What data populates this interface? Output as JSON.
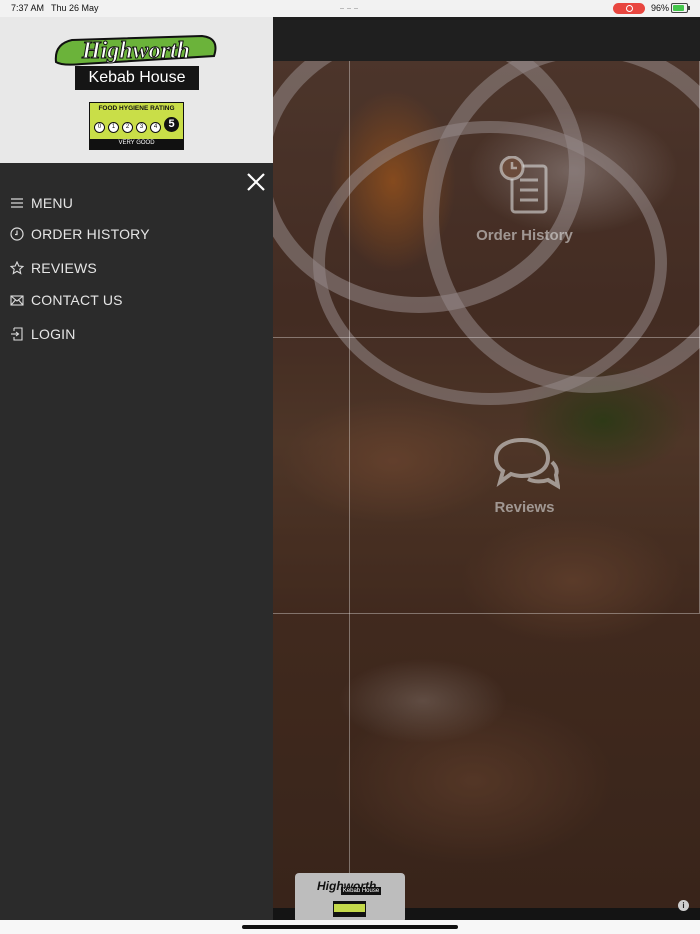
{
  "status_bar": {
    "time": "7:37 AM",
    "date": "Thu 26 May",
    "battery": "96%"
  },
  "brand": {
    "name": "Highworth",
    "subtitle": "Kebab House",
    "hygiene": {
      "title": "FOOD HYGIENE RATING",
      "scores": [
        "0",
        "1",
        "2",
        "3",
        "4"
      ],
      "rating": "5",
      "footer": "VERY GOOD"
    }
  },
  "sidebar": {
    "items": [
      {
        "label": "MENU",
        "icon": "menu-icon"
      },
      {
        "label": "ORDER HISTORY",
        "icon": "clock-icon"
      },
      {
        "label": "REVIEWS",
        "icon": "star-icon"
      },
      {
        "label": "CONTACT US",
        "icon": "envelope-icon"
      },
      {
        "label": "LOGIN",
        "icon": "login-icon"
      }
    ]
  },
  "tiles": [
    {
      "label": "Order History",
      "icon": "order-history-icon"
    },
    {
      "label": "Reviews",
      "icon": "reviews-icon"
    }
  ],
  "mini_logo": {
    "name": "Highworth",
    "subtitle": "Kebab House"
  }
}
